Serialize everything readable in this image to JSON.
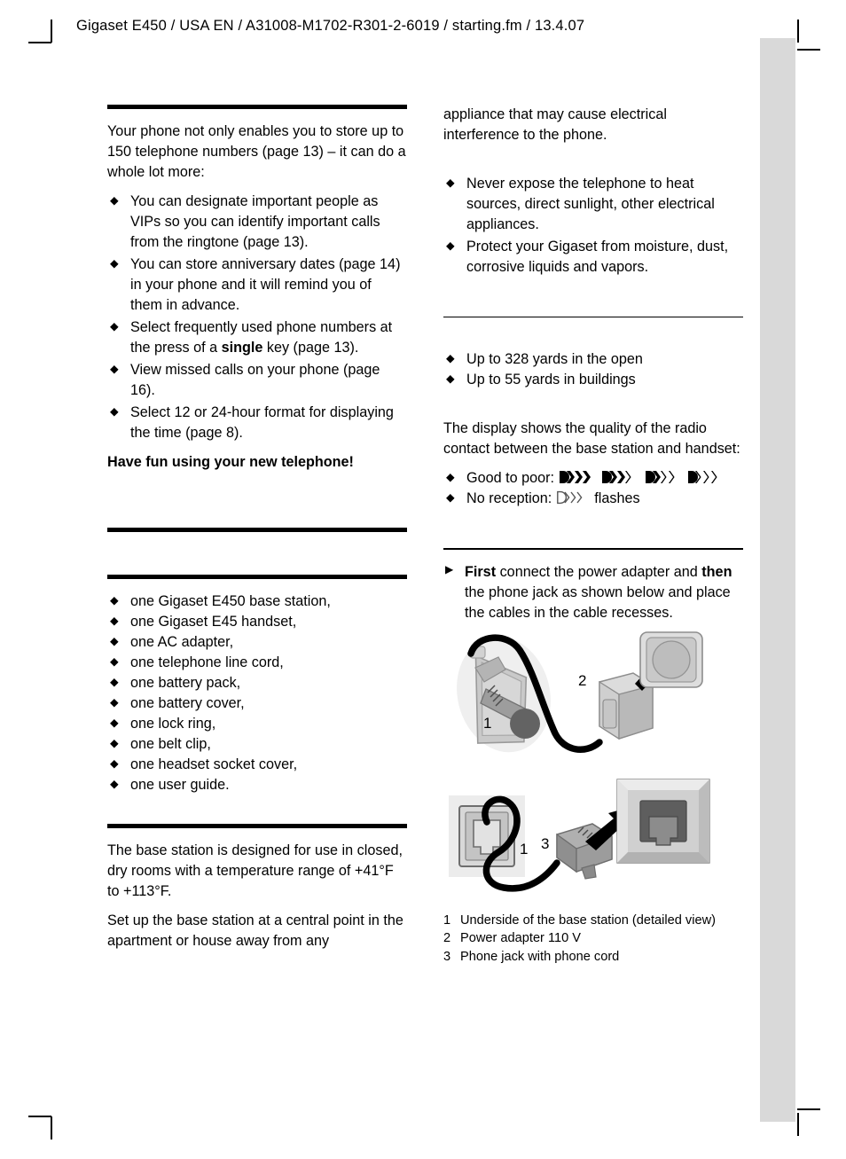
{
  "header": {
    "text": "Gigaset E450 / USA EN / A31008-M1702-R301-2-6019 / starting.fm / 13.4.07"
  },
  "left_column": {
    "intro": {
      "paragraph": "Your phone not only enables you to  store up to 150 telephone numbers (page 13) – it can do a whole lot more:",
      "bullets": [
        "You can designate important people as VIPs so you can identify important calls from the ringtone (page 13).",
        "You can store anniversary dates (page 14) in your phone and it will remind you of them in advance.",
        "Select frequently used phone numbers at the press of a ",
        "View missed calls on your phone (page 16).",
        "Select 12 or 24-hour format for displaying the time (page 8)."
      ],
      "bullet3_prefix": "Select frequently used phone numbers at the press of a ",
      "bullet3_bold": "single",
      "bullet3_suffix": " key (page 13).",
      "closing": "Have fun using your new telephone!"
    },
    "package": {
      "items": [
        "one Gigaset E450 base station,",
        "one Gigaset E45 handset,",
        "one AC adapter,",
        "one telephone line cord,",
        "one battery pack,",
        "one battery cover,",
        "one lock ring,",
        "one belt clip,",
        "one headset socket cover,",
        "one user guide."
      ]
    },
    "placement": {
      "paragraph1": "The base station is designed for use in closed, dry rooms with a temperature range of +41°F to +113°F.",
      "paragraph2": "Set up the base station at a central point in the apartment or house away from any"
    }
  },
  "right_column": {
    "continued": "appliance that may cause electrical interference to the phone.",
    "safety_bullets": [
      "Never expose the telephone to heat sources, direct sunlight, other electrical appliances.",
      "Protect your Gigaset from moisture, dust, corrosive liquids and vapors."
    ],
    "range": {
      "bullets": [
        "Up to 328 yards in the open",
        "Up to 55 yards in buildings"
      ],
      "paragraph": "The display shows the quality of the radio contact between the base station and handset:",
      "good_to_poor_label": "Good to poor:",
      "no_reception_label": "No reception:",
      "no_reception_suffix": "flashes"
    },
    "setup": {
      "step_bold1": "First",
      "step_mid": " connect the power adapter and ",
      "step_bold2": "then",
      "step_rest": " the phone jack as shown below and place the cables in the cable recesses.",
      "figure_callouts": [
        "1",
        "2",
        "1",
        "3"
      ],
      "legend": [
        {
          "num": "1",
          "text": "Underside of the base station (detailed view)"
        },
        {
          "num": "2",
          "text": "Power adapter 110 V"
        },
        {
          "num": "3",
          "text": "Phone jack with phone cord"
        }
      ]
    }
  },
  "colors": {
    "page_background": "#ffffff",
    "text": "#000000",
    "edge_tab": "#d9d9d9",
    "illustration_light": "#e8e8e8",
    "illustration_mid": "#b8b8b8",
    "illustration_dark": "#8a8a8a",
    "illustration_darkest": "#555555"
  }
}
